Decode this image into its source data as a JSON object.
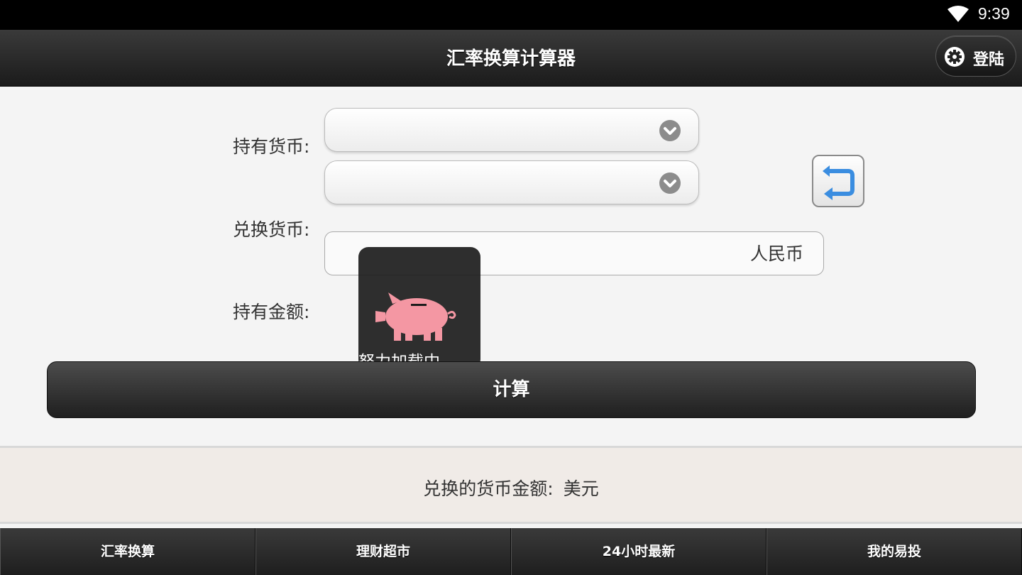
{
  "status_bar": {
    "time": "9:39",
    "wifi_icon": "wifi-icon"
  },
  "header": {
    "title": "汇率换算计算器",
    "login_label": "登陆",
    "login_icon": "gear-icon"
  },
  "form": {
    "held_currency_label": "持有货币:",
    "target_currency_label": "兑换货币:",
    "amount_label": "持有金额:",
    "held_currency_value": "",
    "target_currency_value": "",
    "amount_value": "",
    "amount_unit": "人民币",
    "swap_icon": "swap-arrows-icon"
  },
  "loading": {
    "text": "努力加载中...",
    "icon": "piggy-bank-icon"
  },
  "calculate_button": {
    "label": "计算"
  },
  "result": {
    "label": "兑换的货币金额:",
    "unit": "美元"
  },
  "bottom_nav": {
    "tabs": [
      {
        "label": "汇率换算"
      },
      {
        "label": "理财超市"
      },
      {
        "label": "24小时最新"
      },
      {
        "label": "我的易投"
      }
    ]
  },
  "colors": {
    "accent_swap": "#3a8de0",
    "piggy": "#f497a3",
    "header_dark": "#1b1b1b"
  }
}
